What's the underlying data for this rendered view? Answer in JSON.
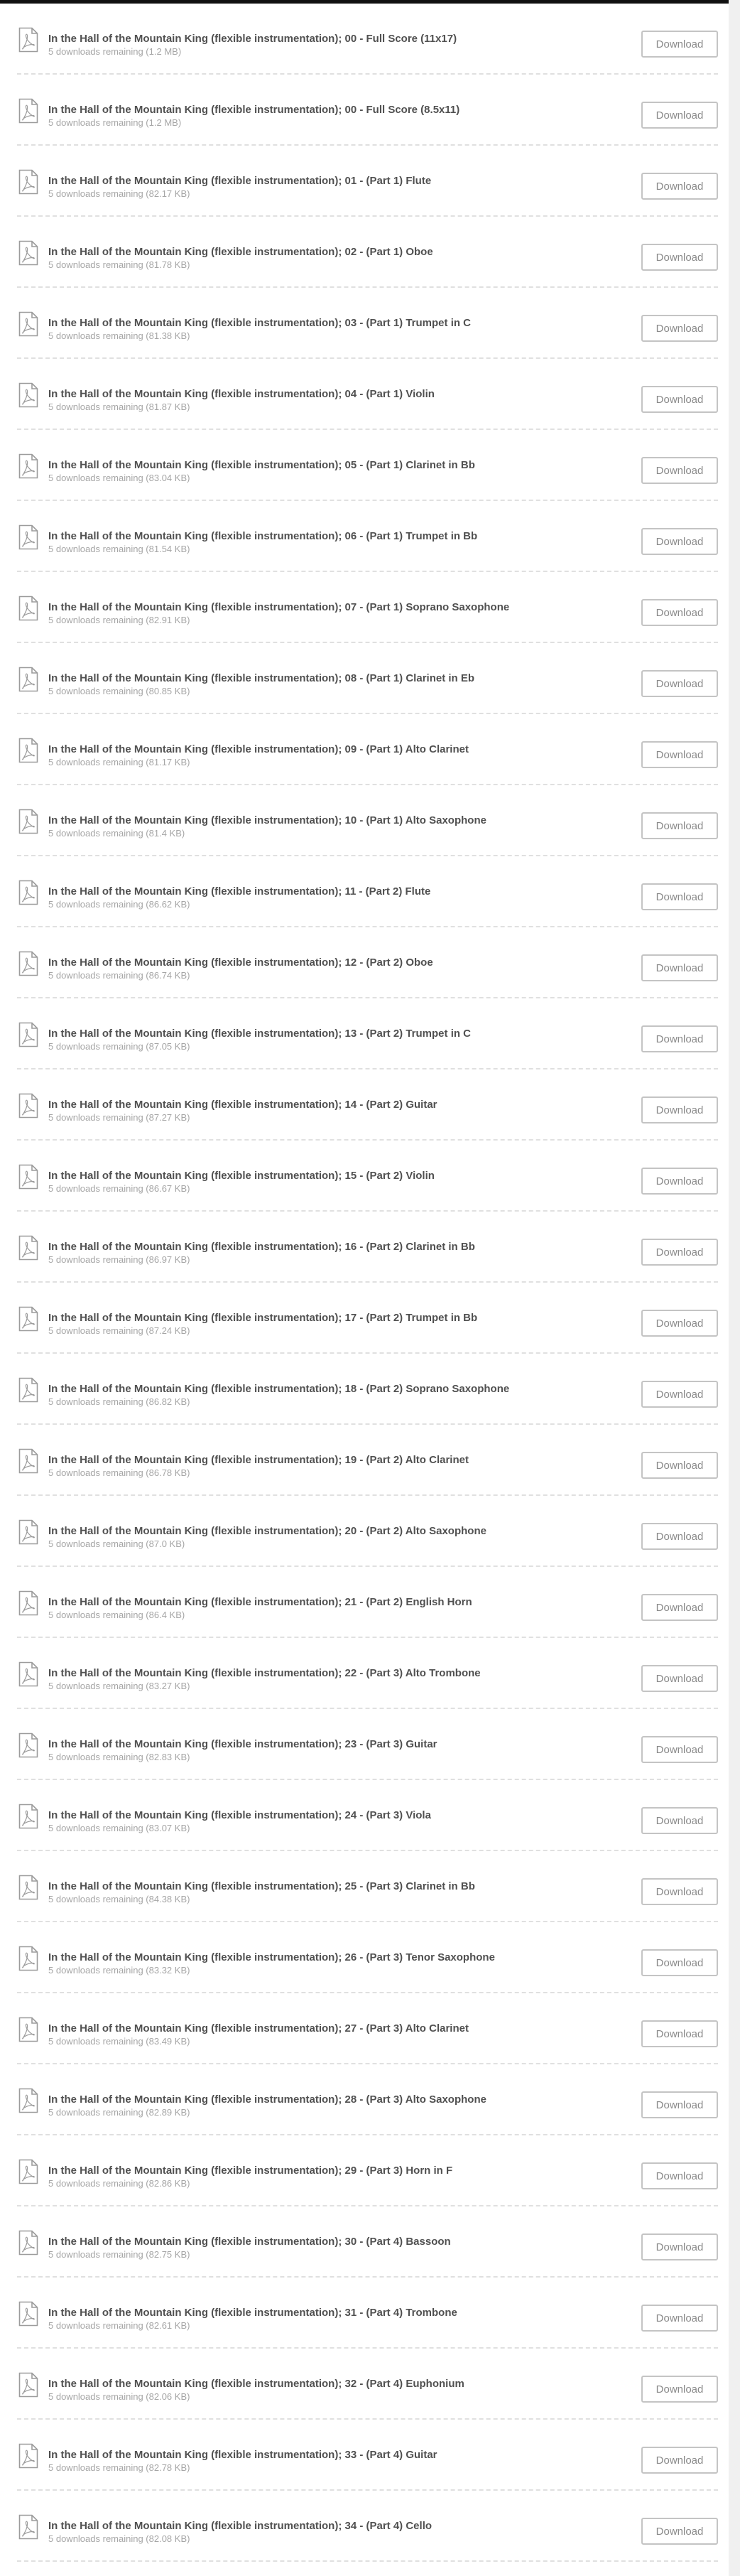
{
  "downloads": {
    "button_label": "Download",
    "icon": "pdf-file-icon",
    "items": [
      {
        "title": "In the Hall of the Mountain King (flexible instrumentation); 00 - Full Score (11x17)",
        "meta": "5 downloads remaining (1.2 MB)"
      },
      {
        "title": "In the Hall of the Mountain King (flexible instrumentation); 00 - Full Score (8.5x11)",
        "meta": "5 downloads remaining (1.2 MB)"
      },
      {
        "title": "In the Hall of the Mountain King (flexible instrumentation); 01 - (Part 1) Flute",
        "meta": "5 downloads remaining (82.17 KB)"
      },
      {
        "title": "In the Hall of the Mountain King (flexible instrumentation); 02 - (Part 1) Oboe",
        "meta": "5 downloads remaining (81.78 KB)"
      },
      {
        "title": "In the Hall of the Mountain King (flexible instrumentation); 03 - (Part 1) Trumpet in C",
        "meta": "5 downloads remaining (81.38 KB)"
      },
      {
        "title": "In the Hall of the Mountain King (flexible instrumentation); 04 - (Part 1) Violin",
        "meta": "5 downloads remaining (81.87 KB)"
      },
      {
        "title": "In the Hall of the Mountain King (flexible instrumentation); 05 - (Part 1) Clarinet in Bb",
        "meta": "5 downloads remaining (83.04 KB)"
      },
      {
        "title": "In the Hall of the Mountain King (flexible instrumentation); 06 - (Part 1) Trumpet in Bb",
        "meta": "5 downloads remaining (81.54 KB)"
      },
      {
        "title": "In the Hall of the Mountain King (flexible instrumentation); 07 - (Part 1) Soprano Saxophone",
        "meta": "5 downloads remaining (82.91 KB)"
      },
      {
        "title": "In the Hall of the Mountain King (flexible instrumentation); 08 - (Part 1) Clarinet in Eb",
        "meta": "5 downloads remaining (80.85 KB)"
      },
      {
        "title": "In the Hall of the Mountain King (flexible instrumentation); 09 - (Part 1) Alto Clarinet",
        "meta": "5 downloads remaining (81.17 KB)"
      },
      {
        "title": "In the Hall of the Mountain King (flexible instrumentation); 10 - (Part 1) Alto Saxophone",
        "meta": "5 downloads remaining (81.4 KB)"
      },
      {
        "title": "In the Hall of the Mountain King (flexible instrumentation); 11 - (Part 2) Flute",
        "meta": "5 downloads remaining (86.62 KB)"
      },
      {
        "title": "In the Hall of the Mountain King (flexible instrumentation); 12 - (Part 2) Oboe",
        "meta": "5 downloads remaining (86.74 KB)"
      },
      {
        "title": "In the Hall of the Mountain King (flexible instrumentation); 13 - (Part 2) Trumpet in C",
        "meta": "5 downloads remaining (87.05 KB)"
      },
      {
        "title": "In the Hall of the Mountain King (flexible instrumentation); 14 - (Part 2) Guitar",
        "meta": "5 downloads remaining (87.27 KB)"
      },
      {
        "title": "In the Hall of the Mountain King (flexible instrumentation); 15 - (Part 2) Violin",
        "meta": "5 downloads remaining (86.67 KB)"
      },
      {
        "title": "In the Hall of the Mountain King (flexible instrumentation); 16 - (Part 2) Clarinet in Bb",
        "meta": "5 downloads remaining (86.97 KB)"
      },
      {
        "title": "In the Hall of the Mountain King (flexible instrumentation); 17 - (Part 2) Trumpet in Bb",
        "meta": "5 downloads remaining (87.24 KB)"
      },
      {
        "title": "In the Hall of the Mountain King (flexible instrumentation); 18 - (Part 2) Soprano Saxophone",
        "meta": "5 downloads remaining (86.82 KB)"
      },
      {
        "title": "In the Hall of the Mountain King (flexible instrumentation); 19 - (Part 2) Alto Clarinet",
        "meta": "5 downloads remaining (86.78 KB)"
      },
      {
        "title": "In the Hall of the Mountain King (flexible instrumentation); 20 - (Part 2) Alto Saxophone",
        "meta": "5 downloads remaining (87.0 KB)"
      },
      {
        "title": "In the Hall of the Mountain King (flexible instrumentation); 21 - (Part 2) English Horn",
        "meta": "5 downloads remaining (86.4 KB)"
      },
      {
        "title": "In the Hall of the Mountain King (flexible instrumentation); 22 - (Part 3) Alto Trombone",
        "meta": "5 downloads remaining (83.27 KB)"
      },
      {
        "title": "In the Hall of the Mountain King (flexible instrumentation); 23 - (Part 3) Guitar",
        "meta": "5 downloads remaining (82.83 KB)"
      },
      {
        "title": "In the Hall of the Mountain King (flexible instrumentation); 24 - (Part 3) Viola",
        "meta": "5 downloads remaining (83.07 KB)"
      },
      {
        "title": "In the Hall of the Mountain King (flexible instrumentation); 25 - (Part 3) Clarinet in Bb",
        "meta": "5 downloads remaining (84.38 KB)"
      },
      {
        "title": "In the Hall of the Mountain King (flexible instrumentation); 26 - (Part 3) Tenor Saxophone",
        "meta": "5 downloads remaining (83.32 KB)"
      },
      {
        "title": "In the Hall of the Mountain King (flexible instrumentation); 27 - (Part 3) Alto Clarinet",
        "meta": "5 downloads remaining (83.49 KB)"
      },
      {
        "title": "In the Hall of the Mountain King (flexible instrumentation); 28 - (Part 3) Alto Saxophone",
        "meta": "5 downloads remaining (82.89 KB)"
      },
      {
        "title": "In the Hall of the Mountain King (flexible instrumentation); 29 - (Part 3) Horn in F",
        "meta": "5 downloads remaining (82.86 KB)"
      },
      {
        "title": "In the Hall of the Mountain King (flexible instrumentation); 30 - (Part 4) Bassoon",
        "meta": "5 downloads remaining (82.75 KB)"
      },
      {
        "title": "In the Hall of the Mountain King (flexible instrumentation); 31 - (Part 4) Trombone",
        "meta": "5 downloads remaining (82.61 KB)"
      },
      {
        "title": "In the Hall of the Mountain King (flexible instrumentation); 32 - (Part 4) Euphonium",
        "meta": "5 downloads remaining (82.06 KB)"
      },
      {
        "title": "In the Hall of the Mountain King (flexible instrumentation); 33 - (Part 4) Guitar",
        "meta": "5 downloads remaining (82.78 KB)"
      },
      {
        "title": "In the Hall of the Mountain King (flexible instrumentation); 34 - (Part 4) Cello",
        "meta": "5 downloads remaining (82.08 KB)"
      }
    ]
  }
}
